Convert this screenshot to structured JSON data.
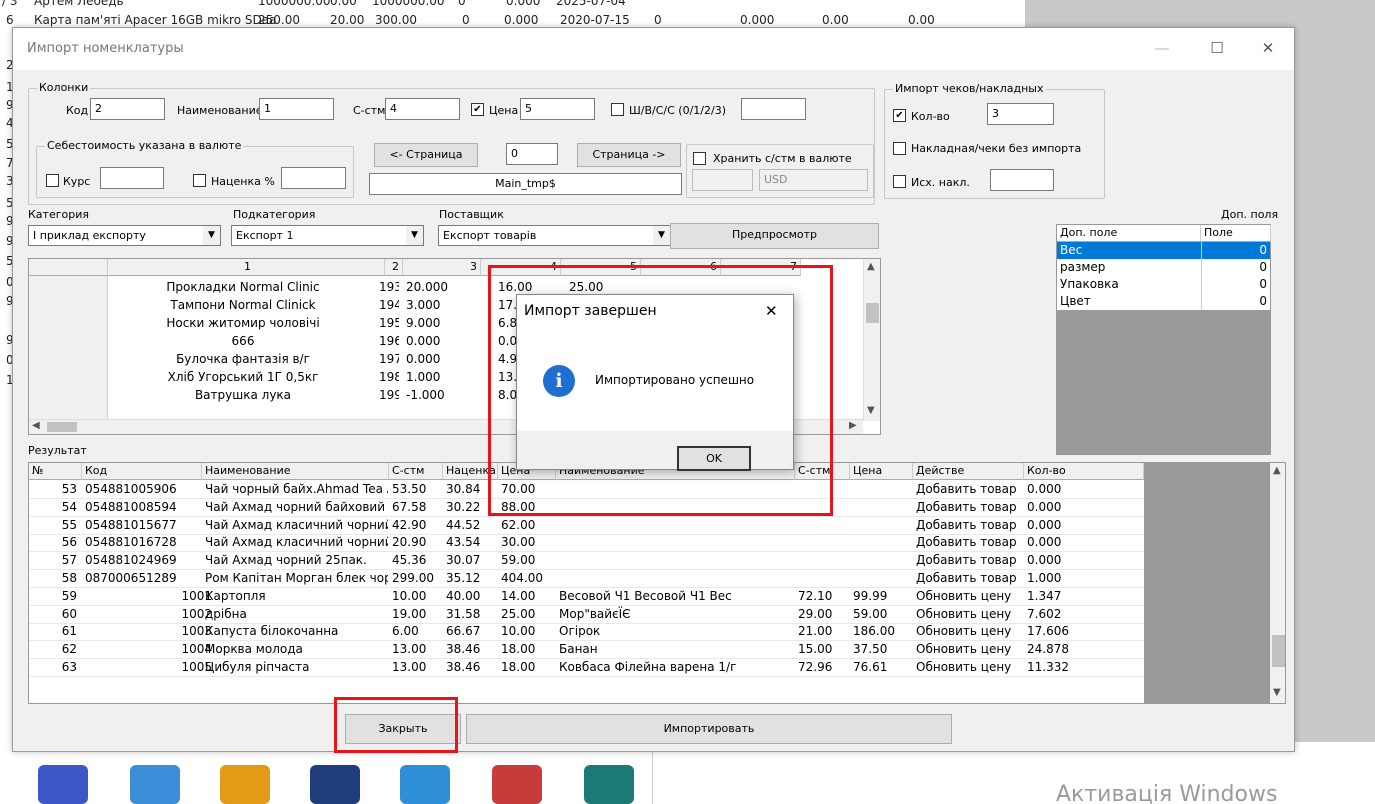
{
  "background_rows": [
    {
      "id": "r73",
      "n": "/ 3",
      "name": "Артем Лебедь",
      "v": [
        "1000000.00",
        "0.00",
        "1000000.00",
        "0",
        "0.000",
        "2025-07-04",
        "0",
        "0.000",
        "0.00",
        "0.00"
      ]
    },
    {
      "id": "r6",
      "n": "6",
      "name": "Карта пам'ятi Apacer 16GB mikro SDaa",
      "v": [
        "250.00",
        "20.00",
        "300.00",
        "0",
        "0.000",
        "2020-07-15",
        "0",
        "0.000",
        "0.00",
        "0.00"
      ]
    }
  ],
  "left_edge_digits": [
    "2",
    "1",
    "9",
    "4",
    "5",
    "7",
    "3",
    "5",
    "9",
    "9",
    "5",
    "0",
    "9",
    "9",
    "0",
    "1"
  ],
  "window": {
    "title": "Импорт номенклатуры",
    "min": "—",
    "max": "☐",
    "close": "✕"
  },
  "columns_group": {
    "caption": "Колонки",
    "code_label": "Код",
    "code_value": "2",
    "name_label": "Наименование",
    "name_value": "1",
    "cost_label": "С-стм",
    "cost_value": "4",
    "price_label": "Цена",
    "price_value": "5",
    "price_checked": "✔",
    "barcode_label": "Ш/В/С/С (0/1/2/3)",
    "barcode_value": ""
  },
  "currency_group": {
    "caption": "Себестоимость указана в валюте",
    "rate_label": "Курс",
    "rate_value": "",
    "markup_label": "Наценка %",
    "markup_value": ""
  },
  "paging": {
    "prev": "<- Страница",
    "page": "0",
    "next": "Страница ->",
    "sheet": "Main_tmp$",
    "store_label": "Хранить с/стм в валюте",
    "currency_value": "",
    "currency_code": "USD"
  },
  "receipts_group": {
    "caption": "Импорт чеков/накладных",
    "qty_label": "Кол-во",
    "qty_value": "3",
    "qty_checked": "✔",
    "noimport_label": "Накладная/чеки без импорта",
    "src_label": "Исх. накл.",
    "src_value": ""
  },
  "filters": {
    "category_label": "Категория",
    "category_value": "I приклад експорту",
    "subcategory_label": "Подкатегория",
    "subcategory_value": "Експорт 1",
    "supplier_label": "Поставщик",
    "supplier_value": "Експорт товарiв",
    "preview": "Предпросмотр"
  },
  "extra": {
    "caption": "Доп. поля",
    "col1": "Доп. поле",
    "col2": "Поле",
    "rows": [
      {
        "name": "Вес",
        "val": "0"
      },
      {
        "name": "размер",
        "val": "0"
      },
      {
        "name": "Упаковка",
        "val": "0"
      },
      {
        "name": "Цвет",
        "val": "0"
      }
    ]
  },
  "preview_grid": {
    "headers": [
      "1",
      "2",
      "3",
      "4",
      "5",
      "6",
      "7"
    ],
    "rows": [
      {
        "c1": "Прокладки Normal Clinic",
        "c2": "193",
        "c3": "20.000",
        "c4": "16.00",
        "c5": "25.00"
      },
      {
        "c1": "Тампони Normal Clinick",
        "c2": "194",
        "c3": "3.000",
        "c4": "17.0",
        "c5": ""
      },
      {
        "c1": "Носки житомир чоловiчi",
        "c2": "195",
        "c3": "9.000",
        "c4": "6.83",
        "c5": ""
      },
      {
        "c1": "666",
        "c2": "196",
        "c3": "0.000",
        "c4": "0.00",
        "c5": ""
      },
      {
        "c1": "Булочка фантазiя в/г",
        "c2": "197",
        "c3": "0.000",
        "c4": "4.90",
        "c5": ""
      },
      {
        "c1": "Хлiб Угорський 1Г 0,5кг",
        "c2": "198",
        "c3": "1.000",
        "c4": "13.0",
        "c5": ""
      },
      {
        "c1": "Ватрушка лука",
        "c2": "199",
        "c3": "-1.000",
        "c4": "8.00",
        "c5": ""
      }
    ]
  },
  "result": {
    "caption": "Результат",
    "headers": [
      "№",
      "Код",
      "Наименование",
      "С-стм",
      "Наценка",
      "Цена",
      "Наименование",
      "С-стм",
      "Цена",
      "Действе",
      "Кол-во"
    ],
    "rows": [
      [
        "53",
        "054881005906",
        "Чай чорный байх.Ahmad Tea Анг",
        "53.50",
        "30.84",
        "70.00",
        "",
        "",
        "",
        "Добавить товар",
        "0.000"
      ],
      [
        "54",
        "054881008594",
        "Чай Ахмад чорний байховий лис",
        "67.58",
        "30.22",
        "88.00",
        "",
        "",
        "",
        "Добавить товар",
        "0.000"
      ],
      [
        "55",
        "054881015677",
        "Чай Ахмад класичний чорний 1С",
        "42.90",
        "44.52",
        "62.00",
        "",
        "",
        "",
        "Добавить товар",
        "0.000"
      ],
      [
        "56",
        "054881016728",
        "Чай Ахмад класичний чорний 2С",
        "20.90",
        "43.54",
        "30.00",
        "",
        "",
        "",
        "Добавить товар",
        "0.000"
      ],
      [
        "57",
        "054881024969",
        "Чай Ахмад чорний 25пак.",
        "45.36",
        "30.07",
        "59.00",
        "",
        "",
        "",
        "Добавить товар",
        "0.000"
      ],
      [
        "58",
        "087000651289",
        "Ром Капiтан Морган блек чорн.е",
        "299.00",
        "35.12",
        "404.00",
        "",
        "",
        "",
        "Добавить товар",
        "1.000"
      ],
      [
        "59",
        "1001",
        "Картопля",
        "10.00",
        "40.00",
        "14.00",
        "Весовой Ч1 Весовой Ч1 Вес",
        "72.10",
        "99.99",
        "Обновить цену",
        "1.347"
      ],
      [
        "60",
        "1002",
        "дрiбна",
        "19.00",
        "31.58",
        "25.00",
        "Мор\"вайєЇЄ",
        "29.00",
        "59.00",
        "Обновить цену",
        "7.602"
      ],
      [
        "61",
        "1003",
        "Капуста бiлокочанна",
        "6.00",
        "66.67",
        "10.00",
        "Огiрок",
        "21.00",
        "186.00",
        "Обновить цену",
        "17.606"
      ],
      [
        "62",
        "1004",
        "Морква молода",
        "13.00",
        "38.46",
        "18.00",
        "Банан",
        "15.00",
        "37.50",
        "Обновить цену",
        "24.878"
      ],
      [
        "63",
        "1005",
        "Цибуля рiпчаста",
        "13.00",
        "38.46",
        "18.00",
        "Ковбаса Фiлейна варена 1/г",
        "72.96",
        "76.61",
        "Обновить цену",
        "11.332"
      ]
    ]
  },
  "buttons": {
    "close": "Закрыть",
    "import": "Импортировать"
  },
  "dialog": {
    "title": "Импорт завершен",
    "message": "Импортировано успешно",
    "ok": "OK",
    "icon": "i",
    "close": "✕"
  },
  "watermark": "Активація Windows",
  "colors": {
    "highlight": "#e8141b",
    "selection": "#0078d7",
    "info": "#1e6fd0"
  }
}
